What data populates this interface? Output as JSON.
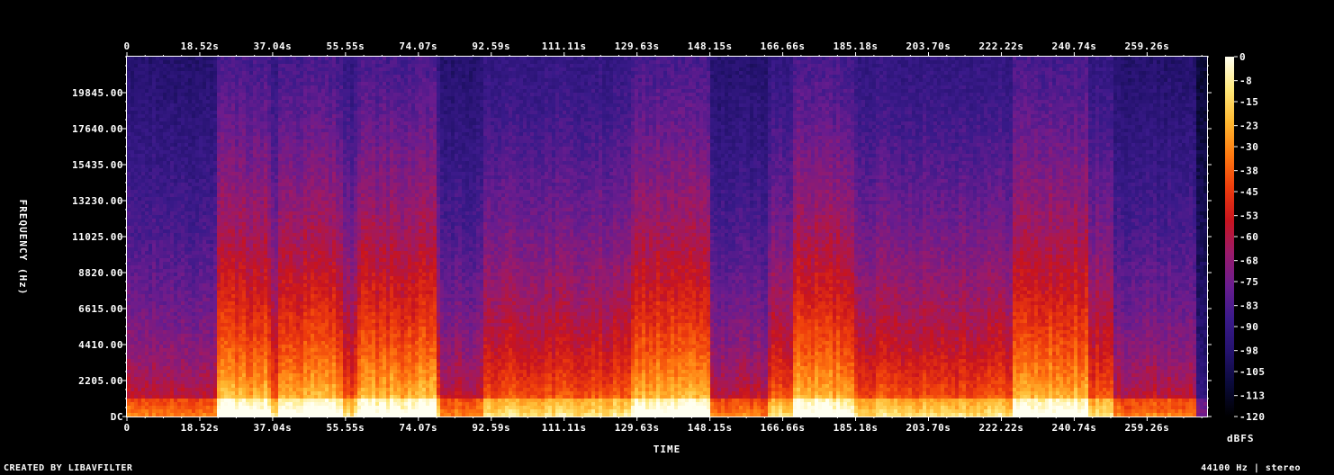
{
  "chart_data": {
    "type": "heatmap",
    "title": "",
    "xlabel": "TIME",
    "ylabel": "FREQUENCY (Hz)",
    "x_unit": "s",
    "x_ticks": [
      "0",
      "18.52s",
      "37.04s",
      "55.55s",
      "74.07s",
      "92.59s",
      "111.11s",
      "129.63s",
      "148.15s",
      "166.66s",
      "185.18s",
      "203.70s",
      "222.22s",
      "240.74s",
      "259.26s"
    ],
    "x_tick_values": [
      0,
      18.52,
      37.04,
      55.55,
      74.07,
      92.59,
      111.11,
      129.63,
      148.15,
      166.66,
      185.18,
      203.7,
      222.22,
      240.74,
      259.26
    ],
    "xlim": [
      0,
      274.5
    ],
    "y_ticks": [
      "DC",
      "2205.00",
      "4410.00",
      "6615.00",
      "8820.00",
      "11025.00",
      "13230.00",
      "15435.00",
      "17640.00",
      "19845.00"
    ],
    "y_tick_values": [
      0,
      2205,
      4410,
      6615,
      8820,
      11025,
      13230,
      15435,
      17640,
      19845
    ],
    "ylim": [
      0,
      22050
    ],
    "colorbar": {
      "label": "dBFS",
      "ticks": [
        "0",
        "-8",
        "-15",
        "-23",
        "-30",
        "-38",
        "-45",
        "-53",
        "-60",
        "-68",
        "-75",
        "-83",
        "-90",
        "-98",
        "-105",
        "-113",
        "-120"
      ],
      "tick_values": [
        0,
        -8,
        -15,
        -23,
        -30,
        -38,
        -45,
        -53,
        -60,
        -68,
        -75,
        -83,
        -90,
        -98,
        -105,
        -113,
        -120
      ],
      "range": [
        -120,
        0
      ]
    },
    "loud_sections_s": [
      [
        23,
        37
      ],
      [
        38,
        55
      ],
      [
        59,
        79
      ],
      [
        128,
        148
      ],
      [
        169,
        185
      ],
      [
        225,
        244
      ]
    ],
    "quiet_sections_s": [
      [
        0,
        6
      ],
      [
        6,
        23
      ],
      [
        80,
        91
      ],
      [
        148,
        152
      ],
      [
        152,
        163
      ],
      [
        251,
        273
      ]
    ]
  },
  "footer": {
    "left": "CREATED BY LIBAVFILTER",
    "right": "44100 Hz | stereo"
  },
  "colors": {
    "background": "#000000",
    "text": "#ffffff",
    "colormap": [
      "#000000",
      "#0a0a3a",
      "#24126e",
      "#3a1a8a",
      "#6a1c8e",
      "#9a1a6a",
      "#c8141e",
      "#ee3c0c",
      "#ff7a10",
      "#ffb830",
      "#ffe87a",
      "#fffff0"
    ]
  }
}
